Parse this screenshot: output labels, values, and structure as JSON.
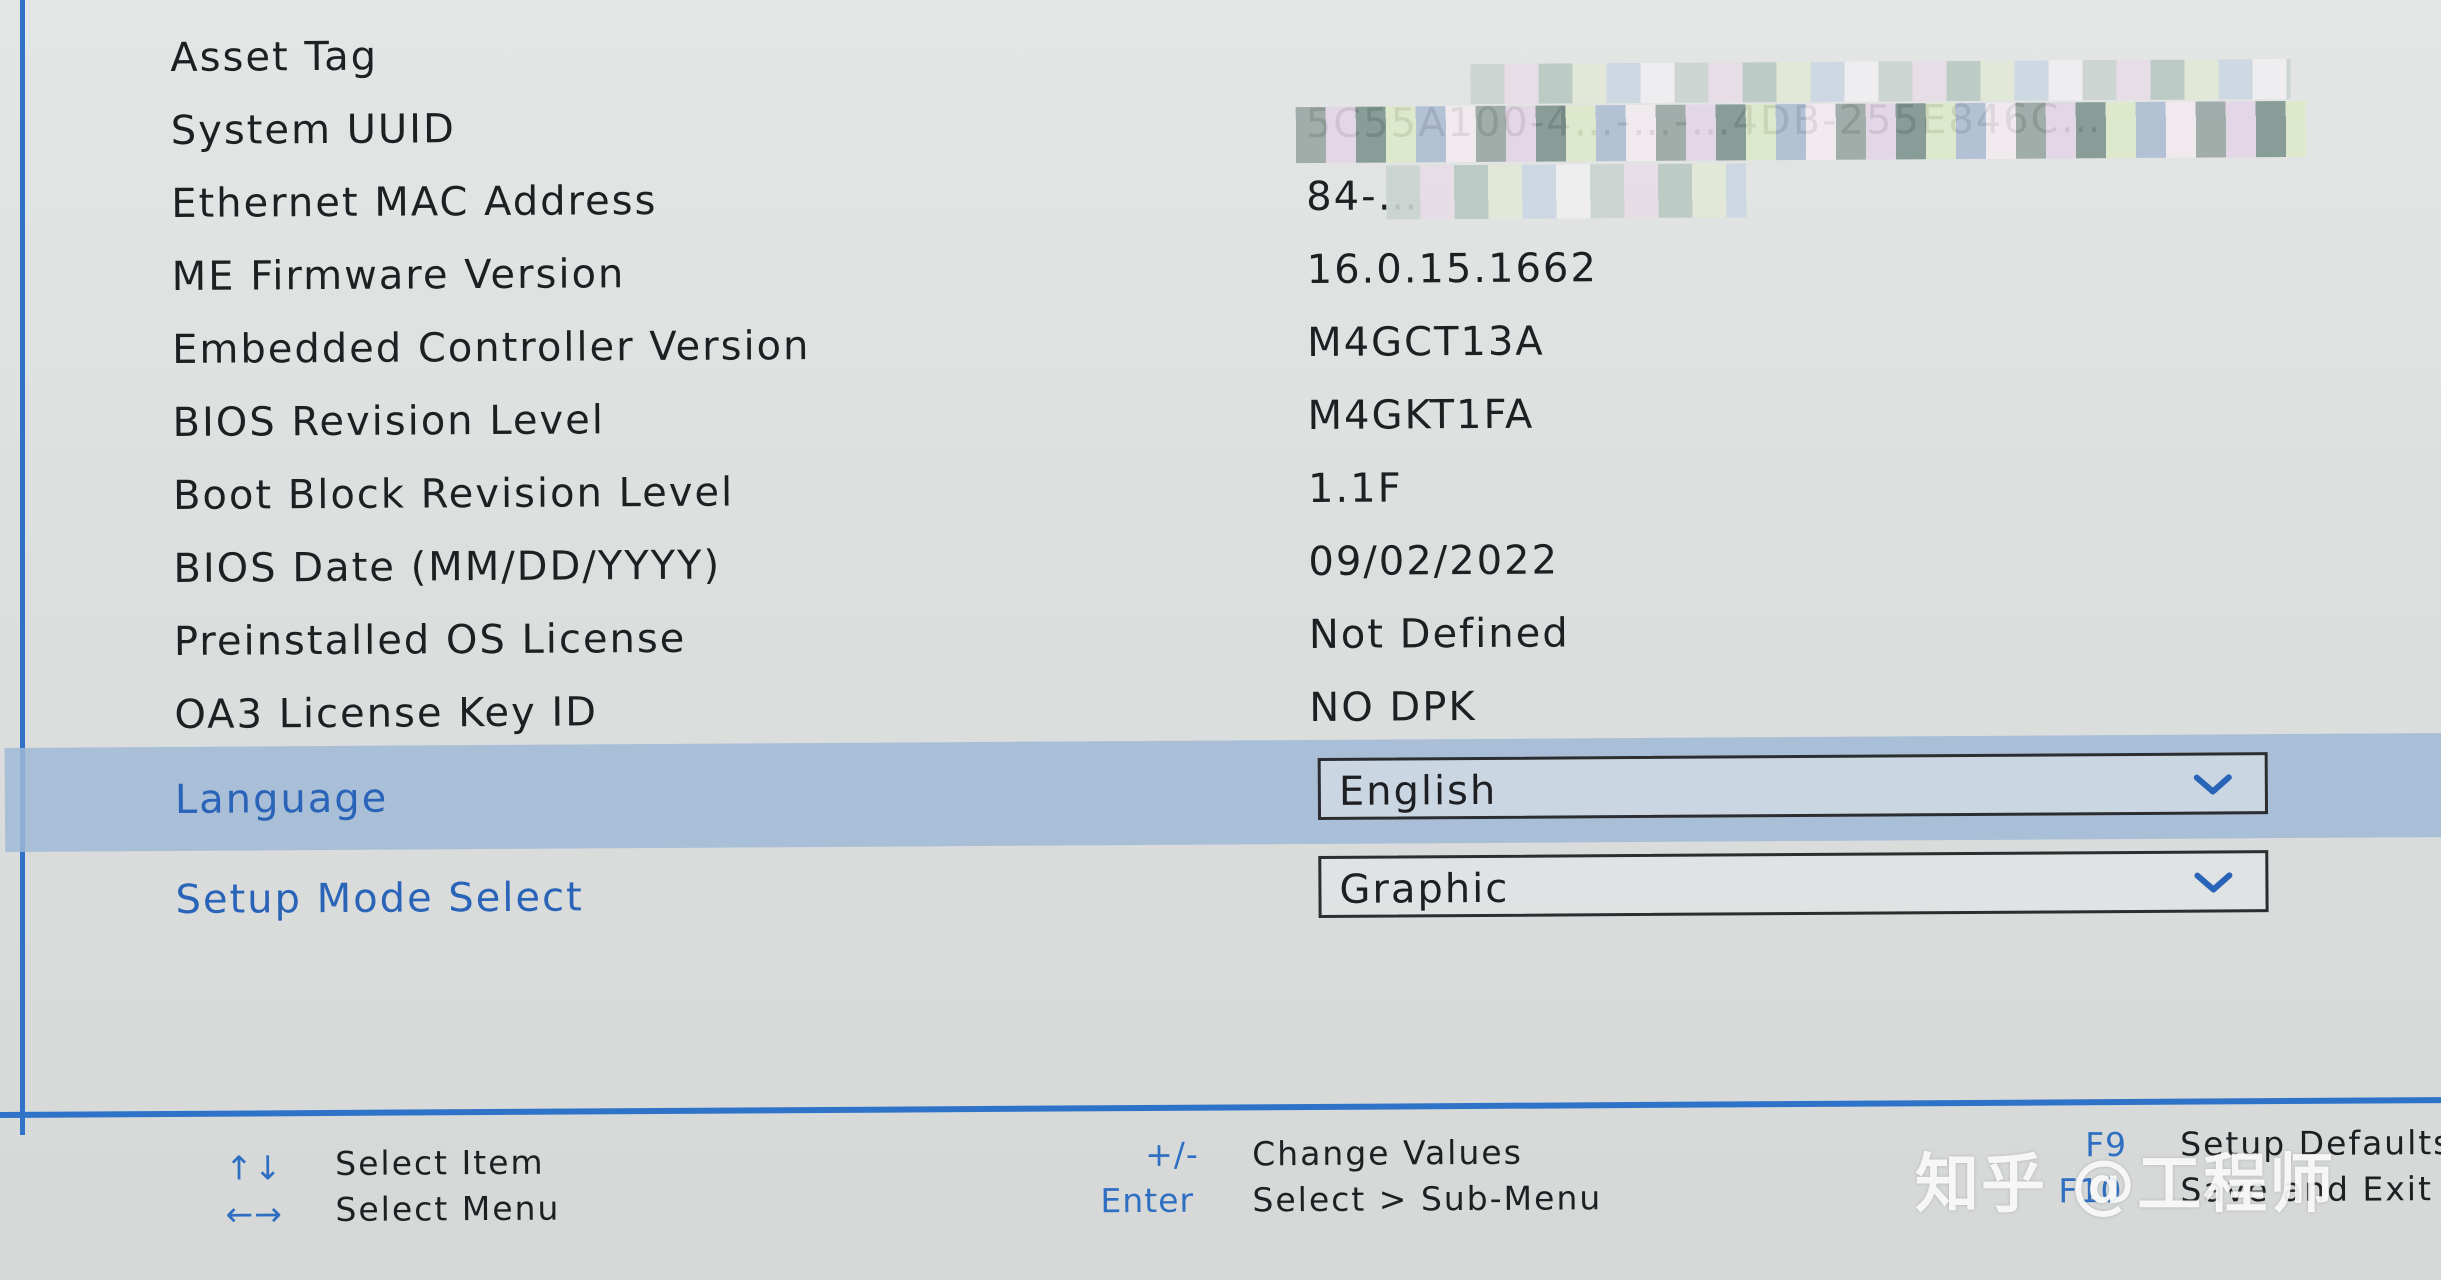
{
  "info_rows": [
    {
      "label": "Asset Tag",
      "value": ""
    },
    {
      "label": "System UUID",
      "value": "5C55A100-4…-…-…4DB-255E846C…"
    },
    {
      "label": "Ethernet MAC Address",
      "value": "84-…"
    },
    {
      "label": "ME Firmware Version",
      "value": "16.0.15.1662"
    },
    {
      "label": "Embedded Controller Version",
      "value": "M4GCT13A"
    },
    {
      "label": "BIOS Revision Level",
      "value": "M4GKT1FA"
    },
    {
      "label": "Boot Block Revision Level",
      "value": "1.1F"
    },
    {
      "label": "BIOS Date (MM/DD/YYYY)",
      "value": "09/02/2022"
    },
    {
      "label": "Preinstalled OS License",
      "value": "Not Defined"
    },
    {
      "label": "OA3 License Key ID",
      "value": "NO DPK"
    }
  ],
  "settings": {
    "language": {
      "label": "Language",
      "value": "English"
    },
    "setup_mode": {
      "label": "Setup Mode Select",
      "value": "Graphic"
    }
  },
  "footer": {
    "select_item": {
      "key": "↑↓",
      "desc": "Select Item"
    },
    "select_menu": {
      "key": "←→",
      "desc": "Select Menu"
    },
    "change_values": {
      "key": "+/-",
      "desc": "Change Values"
    },
    "enter": {
      "key": "Enter",
      "desc": "Select > Sub-Menu"
    },
    "f9": {
      "key": "F9",
      "desc": "Setup Defaults"
    },
    "f10": {
      "key": "F10",
      "desc": "Save and Exit"
    }
  },
  "watermark": "知乎 @工程师",
  "colors": {
    "accent_blue": "#2f73c9",
    "highlight_row": "#a0b8d6",
    "text": "#1d1f22"
  }
}
